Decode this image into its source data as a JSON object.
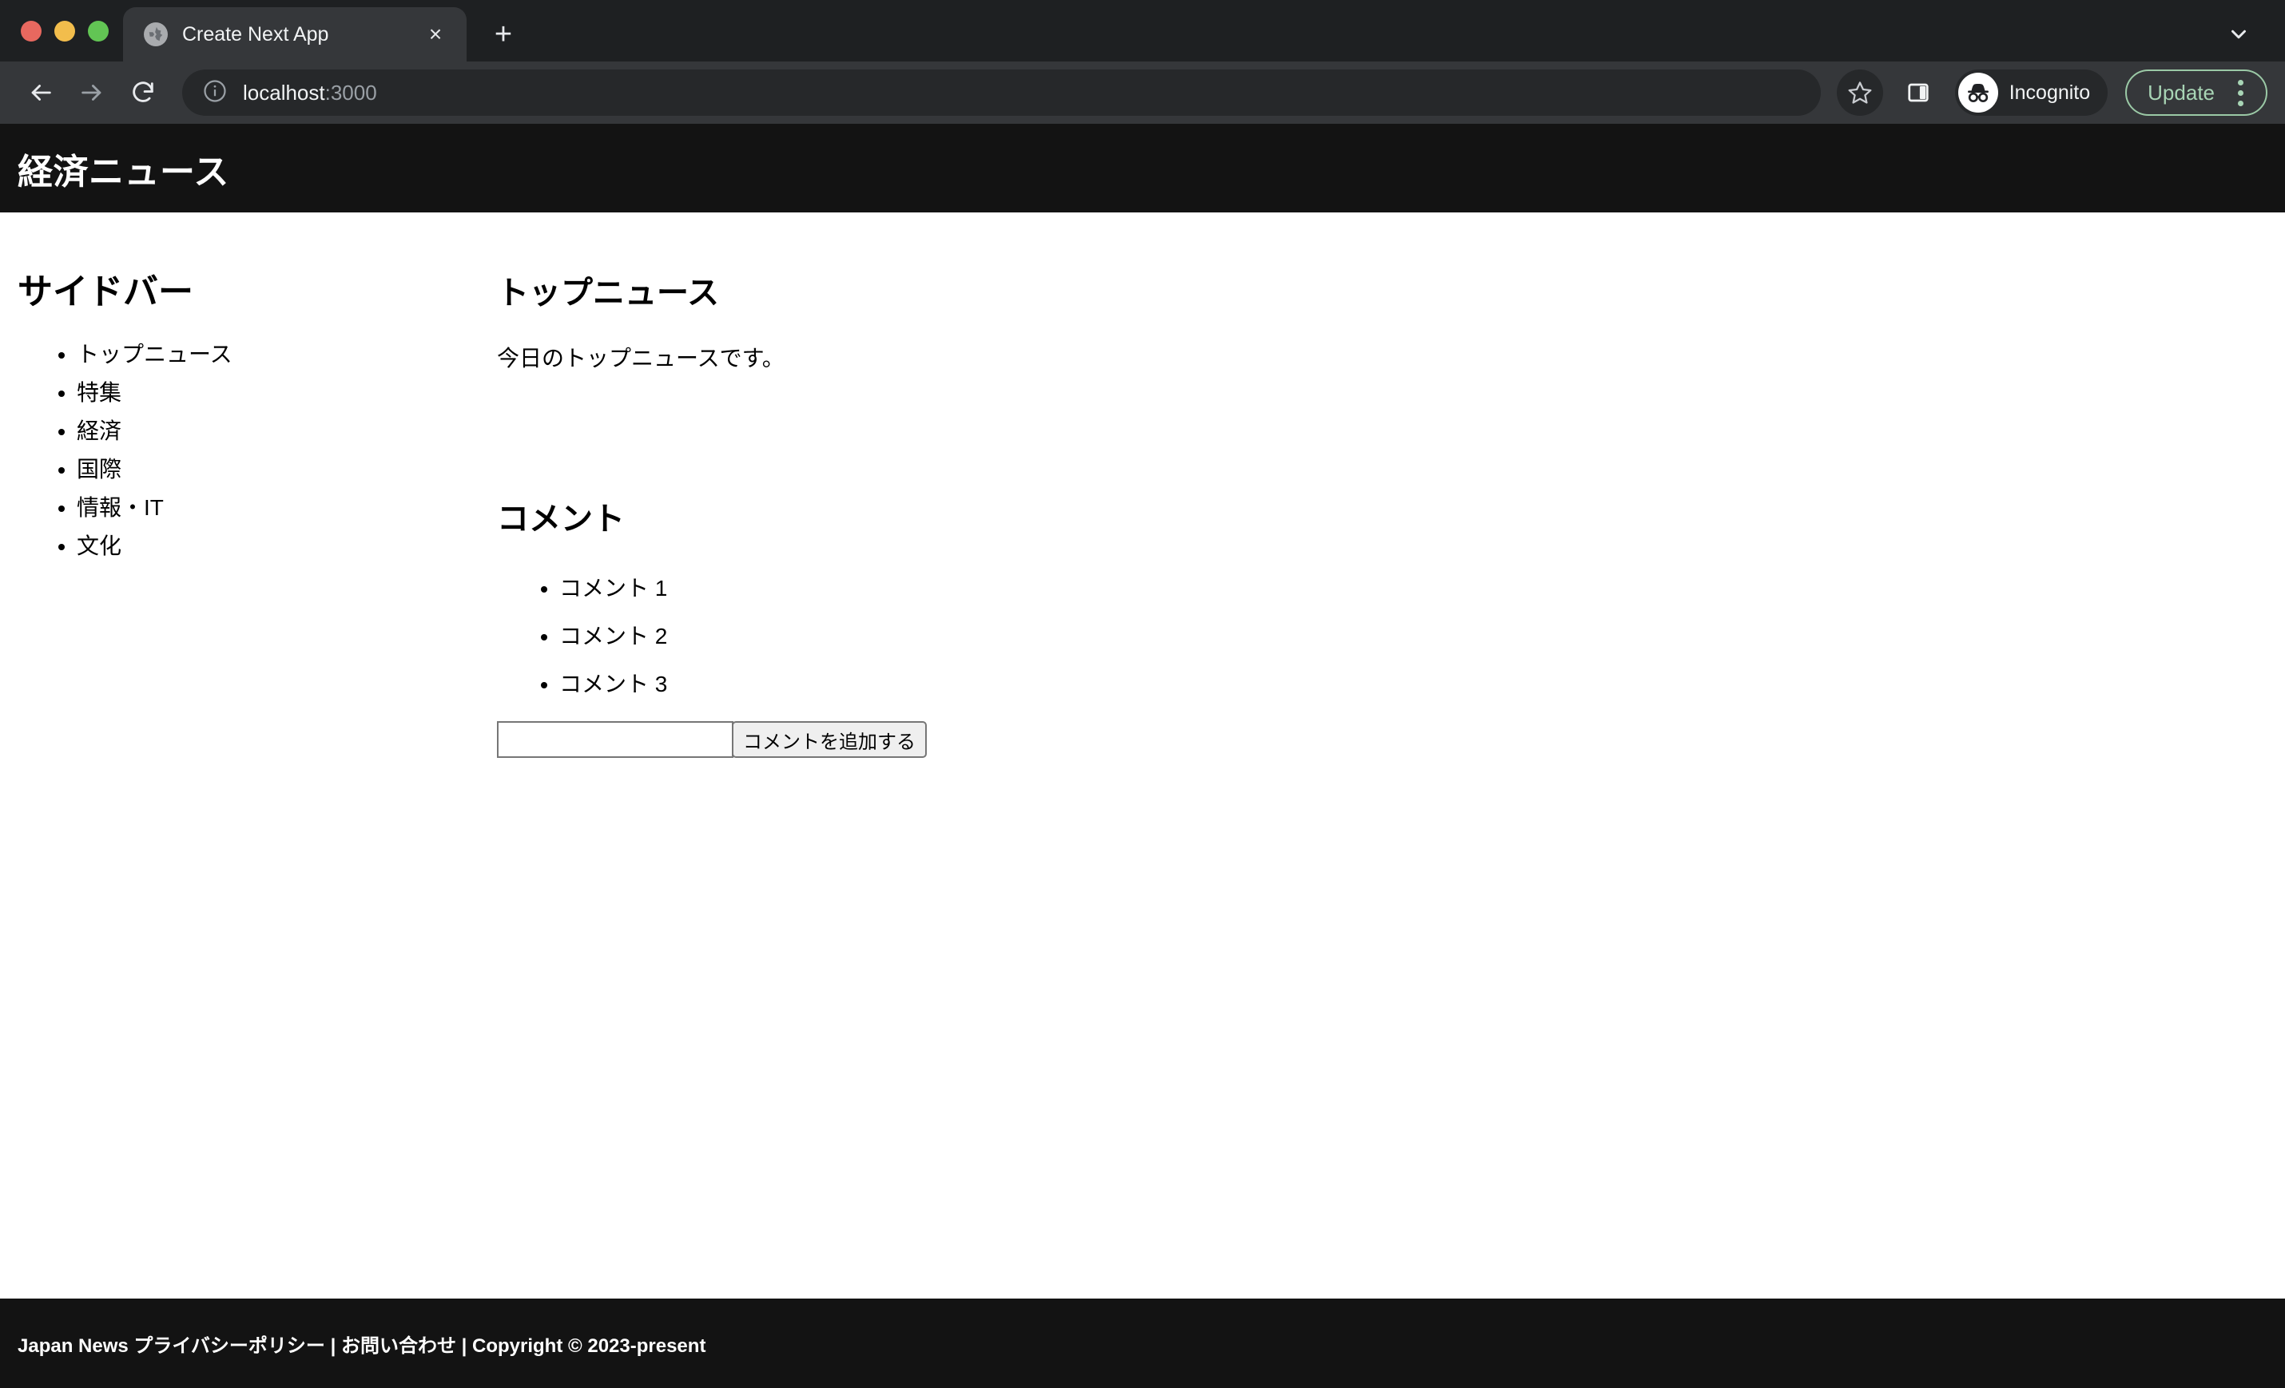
{
  "browser": {
    "window_controls": [
      "close",
      "minimize",
      "zoom"
    ],
    "tab": {
      "title": "Create Next App",
      "favicon": "globe-icon",
      "close_label": "×"
    },
    "new_tab_label": "+",
    "tabstrip_menu_icon": "chevron-down-icon",
    "toolbar": {
      "back_icon": "back-arrow-icon",
      "forward_icon": "forward-arrow-icon",
      "reload_icon": "reload-icon",
      "info_icon": "info-circle-icon",
      "url_main": "localhost",
      "url_port": ":3000",
      "url_full": "localhost:3000",
      "bookmark_icon": "star-icon",
      "side_panel_icon": "side-panel-icon",
      "profile_label": "Incognito",
      "profile_icon": "incognito-avatar-icon",
      "update_label": "Update",
      "menu_icon": "kebab-menu-icon"
    }
  },
  "page": {
    "header": {
      "title": "経済ニュース"
    },
    "sidebar": {
      "heading": "サイドバー",
      "items": [
        {
          "label": "トップニュース"
        },
        {
          "label": "特集"
        },
        {
          "label": "経済"
        },
        {
          "label": "国際"
        },
        {
          "label": "情報・IT"
        },
        {
          "label": "文化"
        }
      ]
    },
    "main": {
      "article_heading": "トップニュース",
      "article_body": "今日のトップニュースです。",
      "comments_heading": "コメント",
      "comments": [
        {
          "text": "コメント 1"
        },
        {
          "text": "コメント 2"
        },
        {
          "text": "コメント 3"
        }
      ],
      "comment_input_value": "",
      "comment_input_placeholder": "",
      "add_comment_button": "コメントを追加する"
    },
    "footer": {
      "text": "Japan News プライバシーポリシー | お問い合わせ | Copyright © 2023-present"
    }
  },
  "colors": {
    "header_bg": "#131313",
    "footer_bg": "#131313",
    "page_bg": "#ffffff",
    "tabstrip_bg": "#1e2022",
    "toolbar_bg": "#35373a",
    "omnibox_bg": "#26282a",
    "update_accent": "#a8d5b5",
    "traffic_red": "#e8685f",
    "traffic_yellow": "#f2bd4c",
    "traffic_green": "#62c554"
  }
}
